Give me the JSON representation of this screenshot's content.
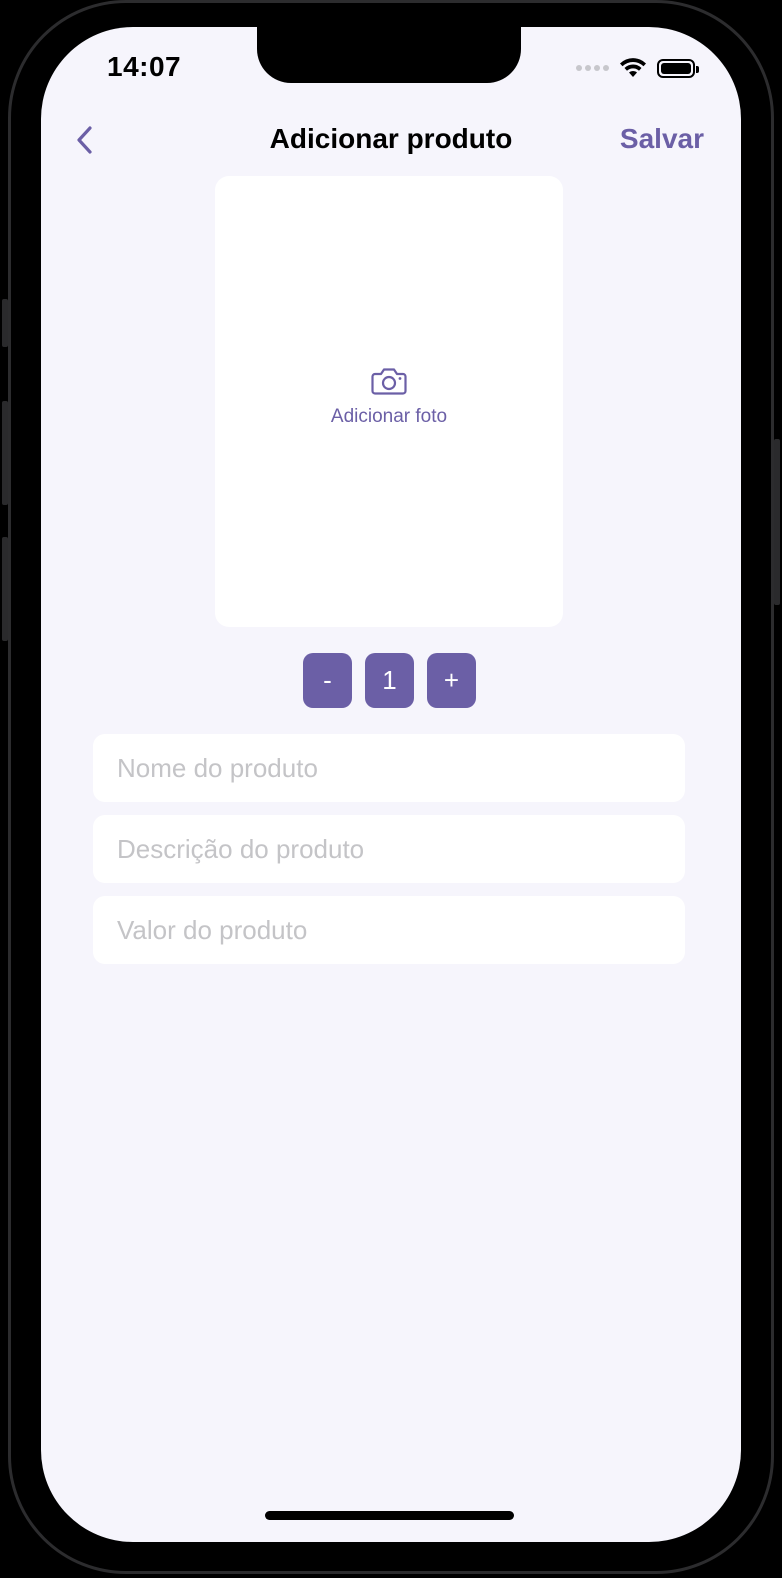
{
  "status_bar": {
    "time": "14:07"
  },
  "nav": {
    "back_icon": "chevron-left-icon",
    "title": "Adicionar produto",
    "save_label": "Salvar"
  },
  "photo": {
    "icon": "camera-icon",
    "label": "Adicionar foto"
  },
  "stepper": {
    "decrement_label": "-",
    "value": "1",
    "increment_label": "+"
  },
  "form": {
    "name_placeholder": "Nome do produto",
    "description_placeholder": "Descrição do produto",
    "price_placeholder": "Valor do produto"
  },
  "colors": {
    "accent": "#6b5fa6",
    "background": "#f6f5fc",
    "placeholder": "#c4c4c7"
  }
}
